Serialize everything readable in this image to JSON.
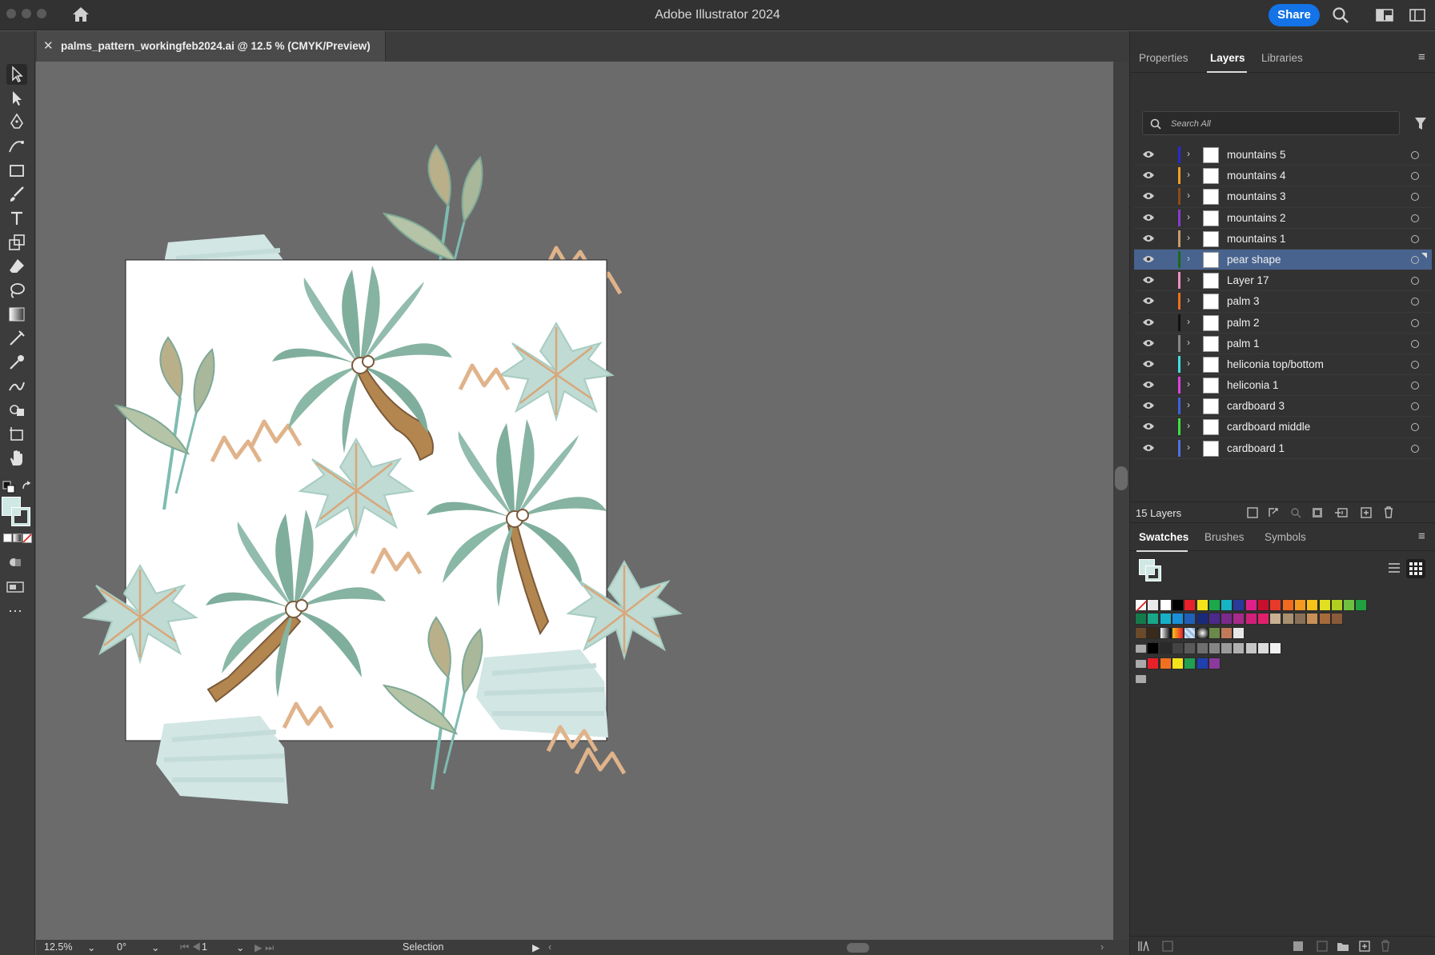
{
  "app": {
    "title": "Adobe Illustrator 2024",
    "share_label": "Share"
  },
  "document": {
    "tab_title": "palms_pattern_workingfeb2024.ai @ 12.5 % (CMYK/Preview)"
  },
  "status": {
    "zoom": "12.5%",
    "rotation": "0°",
    "artboard": "1",
    "tool_name": "Selection"
  },
  "panels": {
    "top_tabs": [
      "Properties",
      "Layers",
      "Libraries"
    ],
    "active_top_tab": "Layers",
    "search_placeholder": "Search All",
    "layer_count": "15 Layers",
    "bottom_tabs": [
      "Swatches",
      "Brushes",
      "Symbols"
    ]
  },
  "layers": [
    {
      "name": "mountains 5",
      "color": "#2a2ad0",
      "selected": false
    },
    {
      "name": "mountains 4",
      "color": "#f0a020",
      "selected": false
    },
    {
      "name": "mountains 3",
      "color": "#8a4a1a",
      "selected": false
    },
    {
      "name": "mountains 2",
      "color": "#8a3ad0",
      "selected": false
    },
    {
      "name": "mountains 1",
      "color": "#c89a6a",
      "selected": false
    },
    {
      "name": "pear shape",
      "color": "#1a6a1a",
      "selected": true
    },
    {
      "name": "Layer 17",
      "color": "#f090c0",
      "selected": false
    },
    {
      "name": "palm 3",
      "color": "#f07020",
      "selected": false
    },
    {
      "name": "palm 2",
      "color": "#111111",
      "selected": false
    },
    {
      "name": "palm 1",
      "color": "#888888",
      "selected": false
    },
    {
      "name": "heliconia top/bottom",
      "color": "#40e0e0",
      "selected": false
    },
    {
      "name": "heliconia 1",
      "color": "#e040e0",
      "selected": false
    },
    {
      "name": "cardboard 3",
      "color": "#4060e0",
      "selected": false
    },
    {
      "name": "cardboard middle",
      "color": "#40e040",
      "selected": false
    },
    {
      "name": "cardboard 1",
      "color": "#5070e0",
      "selected": false
    }
  ],
  "swatches": {
    "row1": [
      "#ffffff",
      "#000000",
      "#e8202a",
      "#f5e31a",
      "#1aa84a",
      "#16b3c4",
      "#2a3a9a",
      "#e0208a",
      "#c8102e",
      "#e83a2a",
      "#f06a20",
      "#f59a20",
      "#f7c21a",
      "#e0e020",
      "#b0d020",
      "#70c040",
      "#20a040"
    ],
    "row2": [
      "#157a4a",
      "#18a888",
      "#16b0c8",
      "#1a90d8",
      "#2060b8",
      "#1a2a7a",
      "#4a2a8a",
      "#7a2a8a",
      "#a82a8a",
      "#d0207a",
      "#e0206a",
      "#c8b090",
      "#a89070",
      "#887058",
      "#c89058",
      "#a86a3a",
      "#8a5a3a"
    ],
    "row3": [
      "#6a4a2a",
      "#3a2a1a"
    ],
    "grays": [
      "#000000",
      "#2a2a2a",
      "#444444",
      "#5a5a5a",
      "#6f6f6f",
      "#858585",
      "#9a9a9a",
      "#b0b0b0",
      "#c6c6c6",
      "#dcdcdc",
      "#f0f0f0"
    ],
    "brights": [
      "#e8202a",
      "#f07020",
      "#f5e31a",
      "#20a050",
      "#2040b0",
      "#8a3a9a"
    ]
  }
}
